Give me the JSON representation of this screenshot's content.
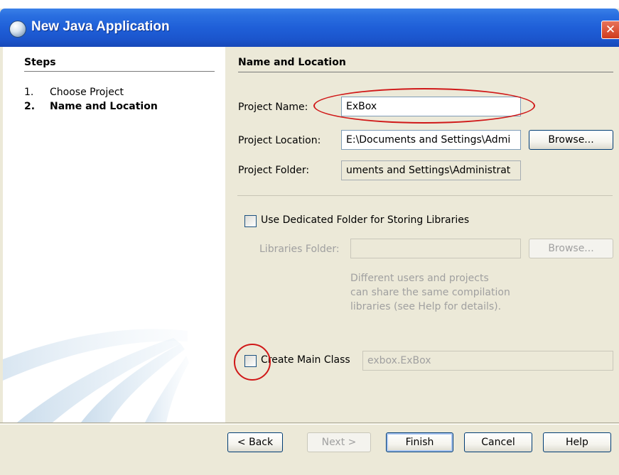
{
  "window": {
    "title": "New Java Application",
    "close_glyph": "✕"
  },
  "steps": {
    "heading": "Steps",
    "items": [
      {
        "num": "1.",
        "label": "Choose Project",
        "current": false
      },
      {
        "num": "2.",
        "label": "Name and Location",
        "current": true
      }
    ]
  },
  "panel": {
    "heading": "Name and Location",
    "project_name": {
      "label": "Project Name:",
      "value": "ExBox"
    },
    "project_location": {
      "label": "Project Location:",
      "value": "E:\\Documents and Settings\\Admi",
      "browse_label": "Browse..."
    },
    "project_folder": {
      "label": "Project Folder:",
      "value": "uments and Settings\\Administrat"
    },
    "dedicated_folder": {
      "label": "Use Dedicated Folder for Storing Libraries",
      "checked": false
    },
    "libraries_folder": {
      "label": "Libraries Folder:",
      "value": "",
      "browse_label": "Browse...",
      "enabled": false
    },
    "libraries_note": [
      "Different users and projects",
      "can share the same compilation",
      "libraries (see Help for details)."
    ],
    "main_class": {
      "label": "Create Main Class",
      "value": "exbox.ExBox",
      "checked": false
    }
  },
  "buttons": {
    "back": "< Back",
    "next": "Next >",
    "finish": "Finish",
    "cancel": "Cancel",
    "help": "Help"
  },
  "colors": {
    "titlebar": "#1f5fd8",
    "dialog_bg": "#ece9d8",
    "annotation_red": "#d01818"
  }
}
